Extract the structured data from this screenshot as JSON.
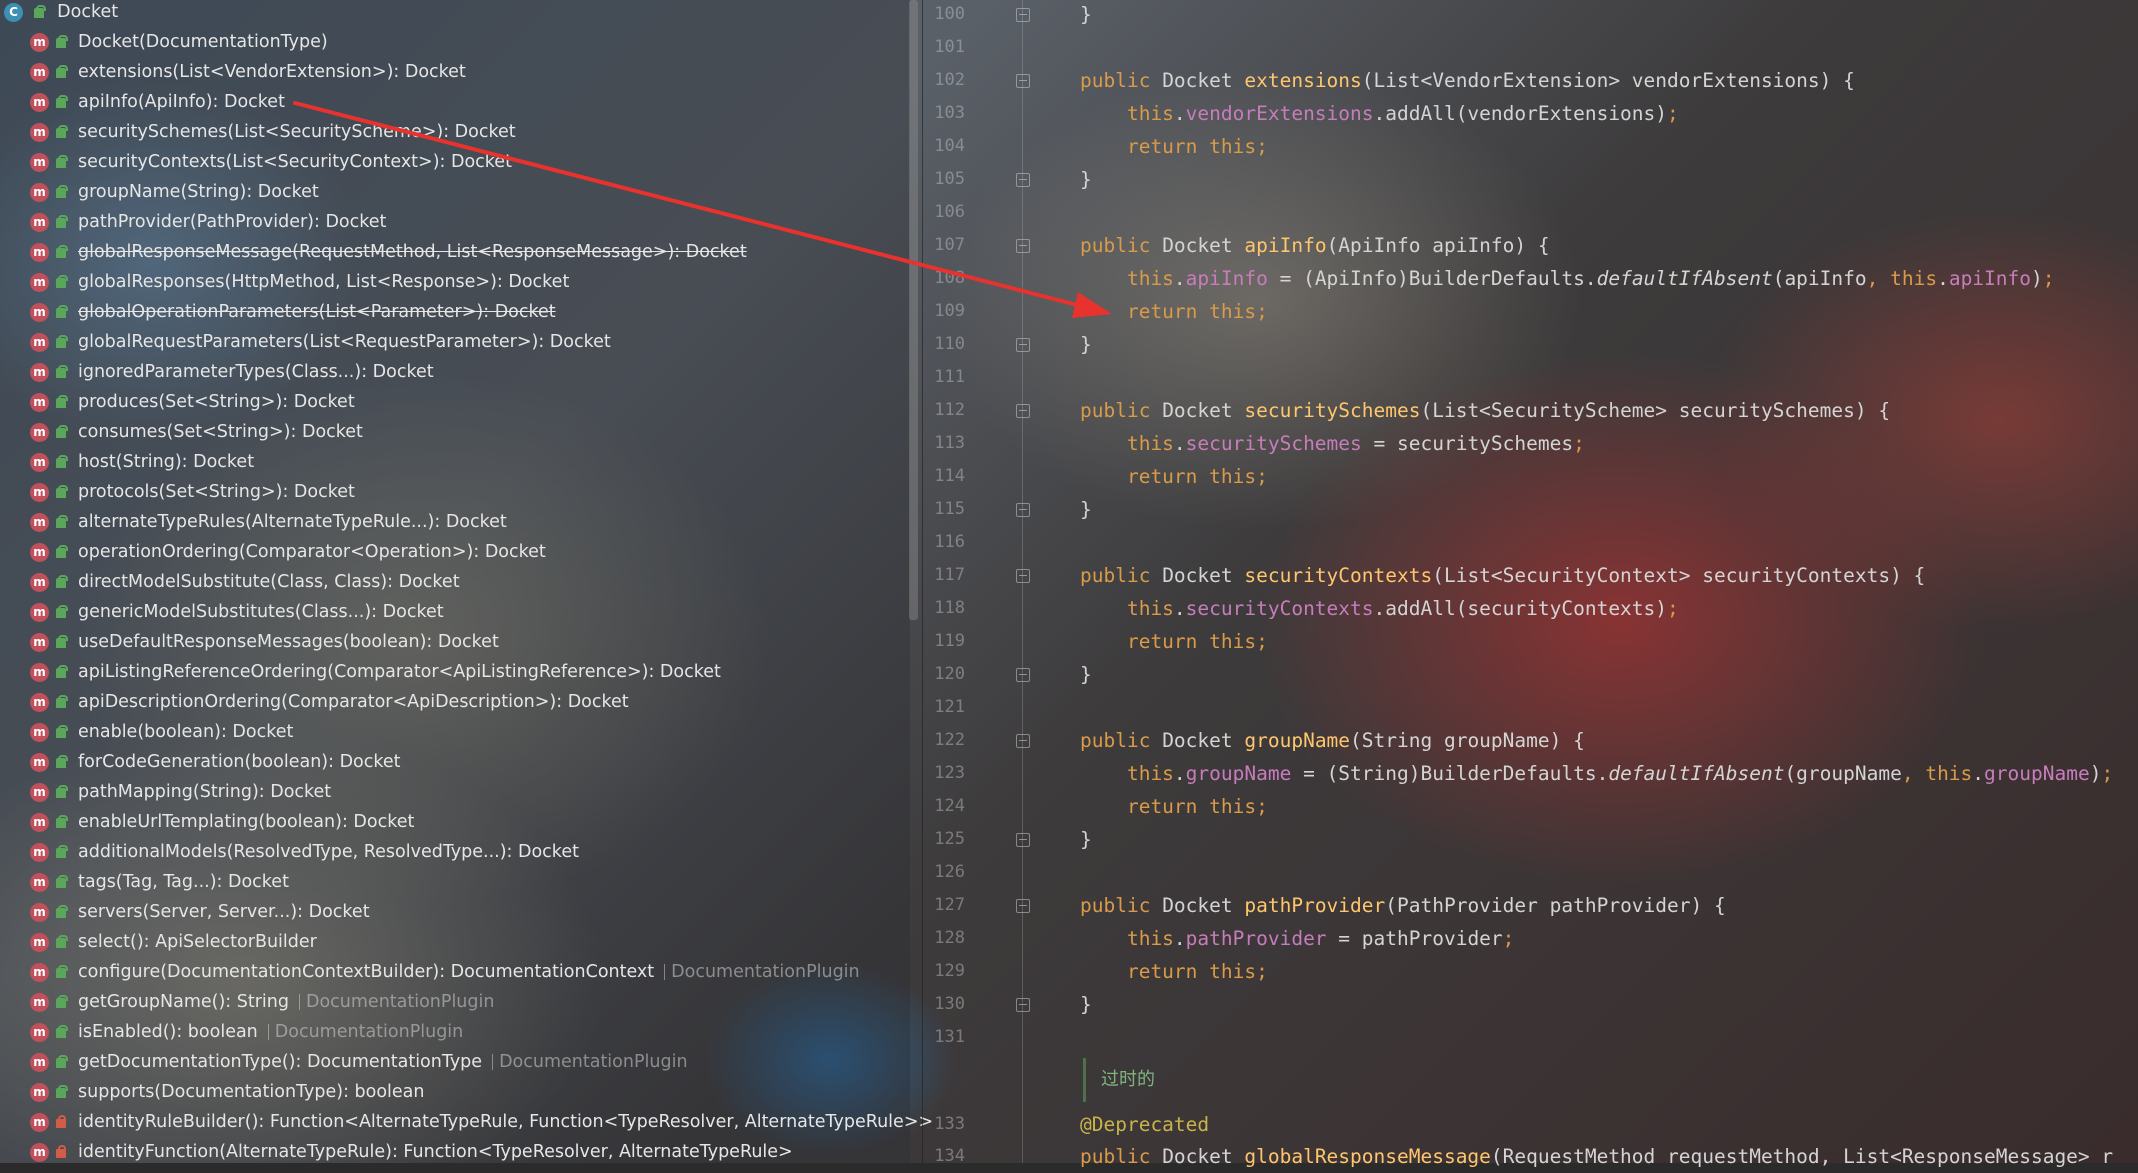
{
  "structure": {
    "root_label": "Docket",
    "root_icon": "class-icon",
    "members": [
      {
        "label": "Docket(DocumentationType)",
        "vis": "pub",
        "struck": false
      },
      {
        "label": "extensions(List<VendorExtension>): Docket",
        "vis": "pub",
        "struck": false
      },
      {
        "label": "apiInfo(ApiInfo): Docket",
        "vis": "pub",
        "struck": false
      },
      {
        "label": "securitySchemes(List<SecurityScheme>): Docket",
        "vis": "pub",
        "struck": false
      },
      {
        "label": "securityContexts(List<SecurityContext>): Docket",
        "vis": "pub",
        "struck": false
      },
      {
        "label": "groupName(String): Docket",
        "vis": "pub",
        "struck": false
      },
      {
        "label": "pathProvider(PathProvider): Docket",
        "vis": "pub",
        "struck": false
      },
      {
        "label": "globalResponseMessage(RequestMethod, List<ResponseMessage>): Docket",
        "vis": "pub",
        "struck": true
      },
      {
        "label": "globalResponses(HttpMethod, List<Response>): Docket",
        "vis": "pub",
        "struck": false
      },
      {
        "label": "globalOperationParameters(List<Parameter>): Docket",
        "vis": "pub",
        "struck": true
      },
      {
        "label": "globalRequestParameters(List<RequestParameter>): Docket",
        "vis": "pub",
        "struck": false
      },
      {
        "label": "ignoredParameterTypes(Class...): Docket",
        "vis": "pub",
        "struck": false
      },
      {
        "label": "produces(Set<String>): Docket",
        "vis": "pub",
        "struck": false
      },
      {
        "label": "consumes(Set<String>): Docket",
        "vis": "pub",
        "struck": false
      },
      {
        "label": "host(String): Docket",
        "vis": "pub",
        "struck": false
      },
      {
        "label": "protocols(Set<String>): Docket",
        "vis": "pub",
        "struck": false
      },
      {
        "label": "alternateTypeRules(AlternateTypeRule...): Docket",
        "vis": "pub",
        "struck": false
      },
      {
        "label": "operationOrdering(Comparator<Operation>): Docket",
        "vis": "pub",
        "struck": false
      },
      {
        "label": "directModelSubstitute(Class, Class): Docket",
        "vis": "pub",
        "struck": false
      },
      {
        "label": "genericModelSubstitutes(Class...): Docket",
        "vis": "pub",
        "struck": false
      },
      {
        "label": "useDefaultResponseMessages(boolean): Docket",
        "vis": "pub",
        "struck": false
      },
      {
        "label": "apiListingReferenceOrdering(Comparator<ApiListingReference>): Docket",
        "vis": "pub",
        "struck": false
      },
      {
        "label": "apiDescriptionOrdering(Comparator<ApiDescription>): Docket",
        "vis": "pub",
        "struck": false
      },
      {
        "label": "enable(boolean): Docket",
        "vis": "pub",
        "struck": false
      },
      {
        "label": "forCodeGeneration(boolean): Docket",
        "vis": "pub",
        "struck": false
      },
      {
        "label": "pathMapping(String): Docket",
        "vis": "pub",
        "struck": false
      },
      {
        "label": "enableUrlTemplating(boolean): Docket",
        "vis": "pub",
        "struck": false
      },
      {
        "label": "additionalModels(ResolvedType, ResolvedType...): Docket",
        "vis": "pub",
        "struck": false
      },
      {
        "label": "tags(Tag, Tag...): Docket",
        "vis": "pub",
        "struck": false
      },
      {
        "label": "servers(Server, Server...): Docket",
        "vis": "pub",
        "struck": false
      },
      {
        "label": "select(): ApiSelectorBuilder",
        "vis": "pub",
        "struck": false
      },
      {
        "label": "configure(DocumentationContextBuilder): DocumentationContext",
        "vis": "pub",
        "struck": false,
        "inherit": "DocumentationPlugin"
      },
      {
        "label": "getGroupName(): String",
        "vis": "pub",
        "struck": false,
        "inherit": "DocumentationPlugin"
      },
      {
        "label": "isEnabled(): boolean",
        "vis": "pub",
        "struck": false,
        "inherit": "DocumentationPlugin"
      },
      {
        "label": "getDocumentationType(): DocumentationType",
        "vis": "pub",
        "struck": false,
        "inherit": "DocumentationPlugin"
      },
      {
        "label": "supports(DocumentationType): boolean",
        "vis": "pub",
        "struck": false
      },
      {
        "label": "identityRuleBuilder(): Function<AlternateTypeRule, Function<TypeResolver, AlternateTypeRule>>",
        "vis": "priv",
        "struck": false
      },
      {
        "label": "identityFunction(AlternateTypeRule): Function<TypeResolver, AlternateTypeRule>",
        "vis": "priv",
        "struck": false
      }
    ]
  },
  "editor": {
    "lines": [
      {
        "n": "100",
        "fold": true,
        "code": [
          [
            "}",
            ""
          ]
        ]
      },
      {
        "n": "101",
        "fold": false,
        "code": []
      },
      {
        "n": "102",
        "fold": true,
        "code": [
          [
            "public ",
            "kw"
          ],
          [
            "Docket ",
            "type"
          ],
          [
            "extensions",
            "fn"
          ],
          [
            "(List<VendorExtension> vendorExtensions) {",
            ""
          ]
        ]
      },
      {
        "n": "103",
        "fold": false,
        "code": [
          [
            "    this",
            "kw"
          ],
          [
            ".",
            ""
          ],
          [
            "vendorExtensions",
            "field"
          ],
          [
            ".addAll(vendorExtensions)",
            ""
          ],
          [
            ";",
            "kw"
          ]
        ]
      },
      {
        "n": "104",
        "fold": false,
        "code": [
          [
            "    return this;",
            "kw"
          ]
        ]
      },
      {
        "n": "105",
        "fold": true,
        "code": [
          [
            "}",
            ""
          ]
        ]
      },
      {
        "n": "106",
        "fold": false,
        "code": []
      },
      {
        "n": "107",
        "fold": true,
        "code": [
          [
            "public ",
            "kw"
          ],
          [
            "Docket ",
            "type"
          ],
          [
            "apiInfo",
            "fn"
          ],
          [
            "(ApiInfo apiInfo) {",
            ""
          ]
        ]
      },
      {
        "n": "108",
        "fold": false,
        "code": [
          [
            "    this",
            "kw"
          ],
          [
            ".",
            ""
          ],
          [
            "apiInfo",
            "field"
          ],
          [
            " = (ApiInfo)BuilderDefaults.",
            ""
          ],
          [
            "defaultIfAbsent",
            "italic"
          ],
          [
            "(apiInfo",
            ""
          ],
          [
            ", ",
            "kw"
          ],
          [
            "this",
            "kw"
          ],
          [
            ".",
            ""
          ],
          [
            "apiInfo",
            "field"
          ],
          [
            ")",
            ""
          ],
          [
            ";",
            "kw"
          ]
        ]
      },
      {
        "n": "109",
        "fold": false,
        "code": [
          [
            "    return this;",
            "kw"
          ]
        ]
      },
      {
        "n": "110",
        "fold": true,
        "code": [
          [
            "}",
            ""
          ]
        ]
      },
      {
        "n": "111",
        "fold": false,
        "code": []
      },
      {
        "n": "112",
        "fold": true,
        "code": [
          [
            "public ",
            "kw"
          ],
          [
            "Docket ",
            "type"
          ],
          [
            "securitySchemes",
            "fn"
          ],
          [
            "(List<SecurityScheme> securitySchemes) {",
            ""
          ]
        ]
      },
      {
        "n": "113",
        "fold": false,
        "code": [
          [
            "    this",
            "kw"
          ],
          [
            ".",
            ""
          ],
          [
            "securitySchemes",
            "field"
          ],
          [
            " = securitySchemes",
            ""
          ],
          [
            ";",
            "kw"
          ]
        ]
      },
      {
        "n": "114",
        "fold": false,
        "code": [
          [
            "    return this;",
            "kw"
          ]
        ]
      },
      {
        "n": "115",
        "fold": true,
        "code": [
          [
            "}",
            ""
          ]
        ]
      },
      {
        "n": "116",
        "fold": false,
        "code": []
      },
      {
        "n": "117",
        "fold": true,
        "code": [
          [
            "public ",
            "kw"
          ],
          [
            "Docket ",
            "type"
          ],
          [
            "securityContexts",
            "fn"
          ],
          [
            "(List<SecurityContext> securityContexts) {",
            ""
          ]
        ]
      },
      {
        "n": "118",
        "fold": false,
        "code": [
          [
            "    this",
            "kw"
          ],
          [
            ".",
            ""
          ],
          [
            "securityContexts",
            "field"
          ],
          [
            ".addAll(securityContexts)",
            ""
          ],
          [
            ";",
            "kw"
          ]
        ]
      },
      {
        "n": "119",
        "fold": false,
        "code": [
          [
            "    return this;",
            "kw"
          ]
        ]
      },
      {
        "n": "120",
        "fold": true,
        "code": [
          [
            "}",
            ""
          ]
        ]
      },
      {
        "n": "121",
        "fold": false,
        "code": []
      },
      {
        "n": "122",
        "fold": true,
        "code": [
          [
            "public ",
            "kw"
          ],
          [
            "Docket ",
            "type"
          ],
          [
            "groupName",
            "fn"
          ],
          [
            "(String groupName) {",
            ""
          ]
        ]
      },
      {
        "n": "123",
        "fold": false,
        "code": [
          [
            "    this",
            "kw"
          ],
          [
            ".",
            ""
          ],
          [
            "groupName",
            "field"
          ],
          [
            " = (String)BuilderDefaults.",
            ""
          ],
          [
            "defaultIfAbsent",
            "italic"
          ],
          [
            "(groupName",
            ""
          ],
          [
            ", ",
            "kw"
          ],
          [
            "this",
            "kw"
          ],
          [
            ".",
            ""
          ],
          [
            "groupName",
            "field"
          ],
          [
            ")",
            ""
          ],
          [
            ";",
            "kw"
          ]
        ]
      },
      {
        "n": "124",
        "fold": false,
        "code": [
          [
            "    return this;",
            "kw"
          ]
        ]
      },
      {
        "n": "125",
        "fold": true,
        "code": [
          [
            "}",
            ""
          ]
        ]
      },
      {
        "n": "126",
        "fold": false,
        "code": []
      },
      {
        "n": "127",
        "fold": true,
        "code": [
          [
            "public ",
            "kw"
          ],
          [
            "Docket ",
            "type"
          ],
          [
            "pathProvider",
            "fn"
          ],
          [
            "(PathProvider pathProvider) {",
            ""
          ]
        ]
      },
      {
        "n": "128",
        "fold": false,
        "code": [
          [
            "    this",
            "kw"
          ],
          [
            ".",
            ""
          ],
          [
            "pathProvider",
            "field"
          ],
          [
            " = pathProvider",
            ""
          ],
          [
            ";",
            "kw"
          ]
        ]
      },
      {
        "n": "129",
        "fold": false,
        "code": [
          [
            "    return this;",
            "kw"
          ]
        ]
      },
      {
        "n": "130",
        "fold": true,
        "code": [
          [
            "}",
            ""
          ]
        ]
      },
      {
        "n": "131",
        "fold": false,
        "code": []
      }
    ],
    "doc_comment": "过时的",
    "line_133_number": "133",
    "line_133_annotation": "@Deprecated",
    "line_134_number": "134",
    "line_134_code": "public Docket globalResponseMessage(RequestMethod requestMethod, List<ResponseMessage> r"
  },
  "colors": {
    "arrow": "#e8322e",
    "method_icon": "#c0505c",
    "class_icon": "#3d8fb5",
    "public_icon": "#5aa65a",
    "private_icon": "#d35b4a"
  }
}
